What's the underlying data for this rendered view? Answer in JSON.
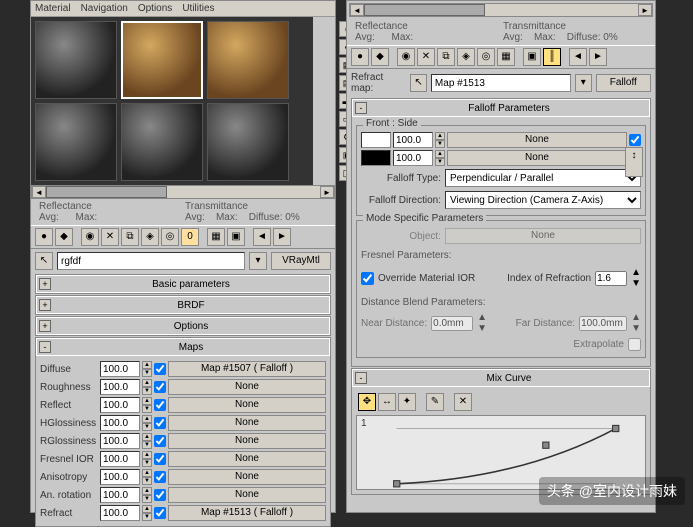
{
  "menu": {
    "material": "Material",
    "navigation": "Navigation",
    "options": "Options",
    "utilities": "Utilities"
  },
  "reflect": {
    "title": "Reflectance",
    "avg": "Avg:",
    "max": "Max:"
  },
  "transmit": {
    "title": "Transmittance",
    "avg": "Avg:",
    "max": "Max:",
    "diffuse": "Diffuse:",
    "diffval": "0%"
  },
  "name": {
    "value": "rgfdf",
    "type": "VRayMtl"
  },
  "rollouts": {
    "basic": "Basic parameters",
    "brdf": "BRDF",
    "options": "Options",
    "maps": "Maps",
    "falloff": "Falloff Parameters",
    "mode": "Mode Specific Parameters",
    "mix": "Mix Curve"
  },
  "maps": [
    {
      "label": "Diffuse",
      "value": "100.0",
      "checked": true,
      "map": "Map #1507 ( Falloff )"
    },
    {
      "label": "Roughness",
      "value": "100.0",
      "checked": true,
      "map": "None"
    },
    {
      "label": "Reflect",
      "value": "100.0",
      "checked": true,
      "map": "None"
    },
    {
      "label": "HGlossiness",
      "value": "100.0",
      "checked": true,
      "map": "None"
    },
    {
      "label": "RGlossiness",
      "value": "100.0",
      "checked": true,
      "map": "None"
    },
    {
      "label": "Fresnel IOR",
      "value": "100.0",
      "checked": true,
      "map": "None"
    },
    {
      "label": "Anisotropy",
      "value": "100.0",
      "checked": true,
      "map": "None"
    },
    {
      "label": "An. rotation",
      "value": "100.0",
      "checked": true,
      "map": "None"
    },
    {
      "label": "Refract",
      "value": "100.0",
      "checked": true,
      "map": "Map #1513 ( Falloff )"
    }
  ],
  "refract": {
    "label": "Refract map:",
    "map": "Map #1513",
    "falloff": "Falloff"
  },
  "falloff": {
    "frontside": "Front : Side",
    "v1": "100.0",
    "m1": "None",
    "v2": "100.0",
    "m2": "None",
    "type_lbl": "Falloff Type:",
    "type": "Perpendicular / Parallel",
    "dir_lbl": "Falloff Direction:",
    "dir": "Viewing Direction (Camera Z-Axis)"
  },
  "mode": {
    "object_lbl": "Object:",
    "object": "None",
    "fresnel_title": "Fresnel Parameters:",
    "override": "Override Material IOR",
    "ior_lbl": "Index of Refraction",
    "ior": "1.6",
    "dist_title": "Distance Blend Parameters:",
    "near_lbl": "Near Distance:",
    "near": "0.0mm",
    "far_lbl": "Far Distance:",
    "far": "100.0mm",
    "extrap": "Extrapolate"
  },
  "watermark": "头条 @室内设计雨妹"
}
